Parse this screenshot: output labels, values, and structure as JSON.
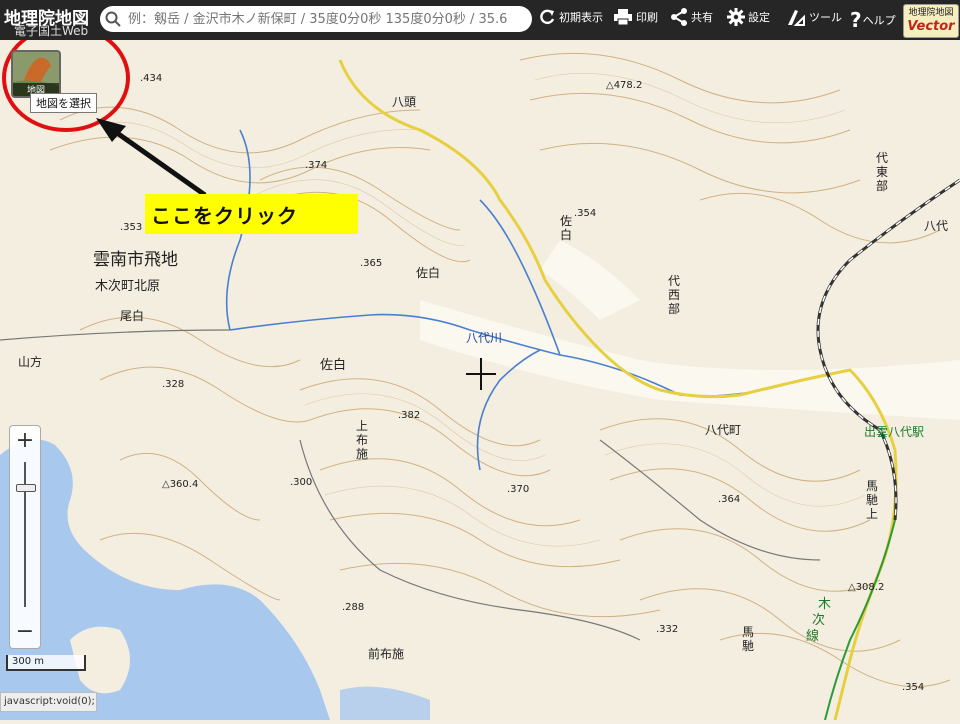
{
  "app": {
    "title": "地理院地図",
    "subtitle": "電子国土Web"
  },
  "search": {
    "placeholder": "例：剱岳 / 金沢市木ノ新保町 / 35度0分0秒 135度0分0秒 / 35.6"
  },
  "toolbar": {
    "reset_label": "初期表示",
    "print_label": "印刷",
    "share_label": "共有",
    "settings_label": "設定",
    "tools_label": "ツール",
    "help_label": "ヘルプ",
    "vector_top": "地理院地図",
    "vector_bottom": "Vector"
  },
  "layer_button": {
    "label": "地図",
    "tooltip": "地図を選択"
  },
  "callout": {
    "text": "ここをクリック"
  },
  "zoom": {
    "plus": "+",
    "minus": "−"
  },
  "scale": {
    "label": "300 m"
  },
  "status": {
    "text": "javascript:void(0);"
  },
  "map_labels": {
    "city_enclave": "雲南市飛地",
    "kitsugi": "木次町北原",
    "owashiro": "尾白",
    "yamagata": "山方",
    "sashiro_left": "佐白",
    "sashiro_mid": "佐白",
    "sashiro_top": "佐\n白",
    "kamifuse": "上\n布\n施",
    "maefuse": "前布施",
    "yatsuka_river": "八代川",
    "hakkashira": "八頭",
    "yashiro_west": "代\n西\n部",
    "yashiro_east": "代\n東\n部",
    "yashiro_right": "八代",
    "yashiro_town": "八代町",
    "station": "出雲八代駅",
    "mabase_top": "馬\n馳\n上",
    "mabase": "馬\n馳",
    "kisuki_line": "木次線",
    "h434": ".434",
    "h374": ".374",
    "h365": ".365",
    "h353": ".353",
    "h328": ".328",
    "h360": "△360.4",
    "h382": ".382",
    "h300": ".300",
    "h370": ".370",
    "h288": ".288",
    "h478": "△478.2",
    "h354": ".354",
    "h364": ".364",
    "h332": ".332",
    "h308": "△308.2",
    "h354b": ".354"
  },
  "colors": {
    "annotation_red": "#e01010",
    "callout_yellow": "#ffff00",
    "water": "#a9c8ee",
    "road_yellow": "#e8d23a",
    "contour": "#c8a46c"
  }
}
